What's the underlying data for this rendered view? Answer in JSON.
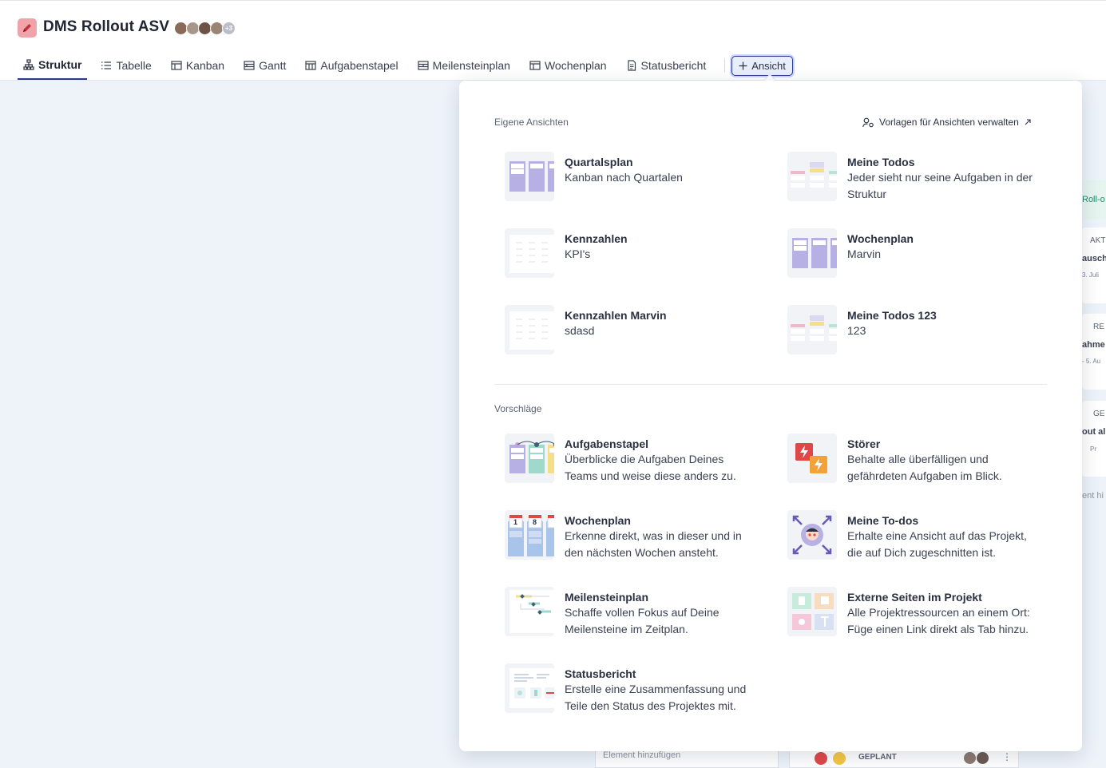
{
  "project": {
    "title": "DMS Rollout ASV",
    "avatar_more": "+3"
  },
  "colors": {
    "accent": "#2b3a8c",
    "project_icon": "#f0a3a8",
    "purple": "#b7b0e4",
    "teal": "#9ed9cc",
    "red": "#e04848",
    "orange": "#f2a238"
  },
  "tabs": [
    {
      "label": "Struktur",
      "icon": "hierarchy-icon"
    },
    {
      "label": "Tabelle",
      "icon": "list-icon"
    },
    {
      "label": "Kanban",
      "icon": "kanban-icon"
    },
    {
      "label": "Gantt",
      "icon": "gantt-icon"
    },
    {
      "label": "Aufgabenstapel",
      "icon": "stack-icon"
    },
    {
      "label": "Meilensteinplan",
      "icon": "milestone-icon"
    },
    {
      "label": "Wochenplan",
      "icon": "calendar-icon"
    },
    {
      "label": "Statusbericht",
      "icon": "report-icon"
    }
  ],
  "add_view_label": "Ansicht",
  "panel": {
    "own_label": "Eigene Ansichten",
    "manage_label": "Vorlagen für Ansichten verwalten",
    "suggest_label": "Vorschläge",
    "own": [
      {
        "title": "Quartalsplan",
        "desc": "Kanban nach Quartalen"
      },
      {
        "title": "Meine Todos",
        "desc": "Jeder sieht nur seine Aufgaben in der Struktur"
      },
      {
        "title": "Kennzahlen",
        "desc": "KPI's"
      },
      {
        "title": "Wochenplan",
        "desc": "Marvin"
      },
      {
        "title": "Kennzahlen Marvin",
        "desc": "sdasd"
      },
      {
        "title": "Meine Todos 123",
        "desc": "123"
      }
    ],
    "suggestions": [
      {
        "title": "Aufgabenstapel",
        "desc": "Überblicke die Aufgaben Deines Teams und weise diese anders zu."
      },
      {
        "title": "Störer",
        "desc": "Behalte alle überfälligen und gefährdeten Aufgaben im Blick."
      },
      {
        "title": "Wochenplan",
        "desc": "Erkenne direkt, was in dieser und in den nächsten Wochen ansteht.",
        "day1": "1",
        "day2": "8"
      },
      {
        "title": "Meine To-dos",
        "desc": "Erhalte eine Ansicht auf das Projekt, die auf Dich zugeschnitten ist."
      },
      {
        "title": "Meilensteinplan",
        "desc": "Schaffe vollen Fokus auf Deine Meilensteine im Zeitplan."
      },
      {
        "title": "Externe Seiten im Projekt",
        "desc": "Alle Projektressourcen an einem Ort: Füge einen Link direkt als Tab hinzu."
      },
      {
        "title": "Statusbericht",
        "desc": "Erstelle eine Zusammenfassung und Teile den Status des Projektes mit."
      }
    ]
  },
  "background": {
    "peek1": "Roll-o",
    "peek2": "AKT",
    "peek3": "ausch",
    "peek4": "3. Juli",
    "peek5": "RE",
    "peek6": "ahme",
    "peek7": "- 5. Au",
    "peek8": "GE",
    "peek9": "out al",
    "peek10": "Pr",
    "peek11": "ent hi",
    "add_element": "Element hinzufügen",
    "status": "GEPLANT"
  }
}
